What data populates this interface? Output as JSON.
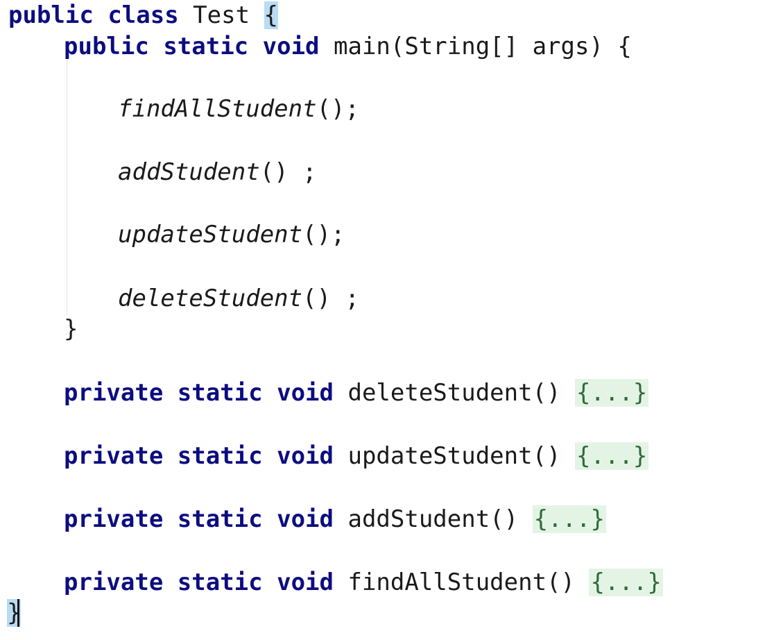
{
  "code": {
    "line1": {
      "kw1": "public",
      "kw2": "class",
      "name": "Test",
      "brace": "{"
    },
    "line2": {
      "kw1": "public",
      "kw2": "static",
      "kw3": "void",
      "sig": "main(String[] args)",
      "brace": "{"
    },
    "calls": [
      {
        "name": "findAllStudent",
        "suffix": "();"
      },
      {
        "name": "addStudent",
        "suffix": "() ;"
      },
      {
        "name": "updateStudent",
        "suffix": "();"
      },
      {
        "name": "deleteStudent",
        "suffix": "() ;"
      }
    ],
    "close_main": "}",
    "methods": [
      {
        "kw1": "private",
        "kw2": "static",
        "kw3": "void",
        "sig": "deleteStudent()",
        "fold": "{...}"
      },
      {
        "kw1": "private",
        "kw2": "static",
        "kw3": "void",
        "sig": "updateStudent()",
        "fold": "{...}"
      },
      {
        "kw1": "private",
        "kw2": "static",
        "kw3": "void",
        "sig": "addStudent()",
        "fold": "{...}"
      },
      {
        "kw1": "private",
        "kw2": "static",
        "kw3": "void",
        "sig": "findAllStudent()",
        "fold": "{...}"
      }
    ],
    "close_class": "}"
  },
  "colors": {
    "keyword": "#0d0d80",
    "fold_background": "#e4f4e4",
    "brace_match_highlight": "#b8dcf2"
  }
}
